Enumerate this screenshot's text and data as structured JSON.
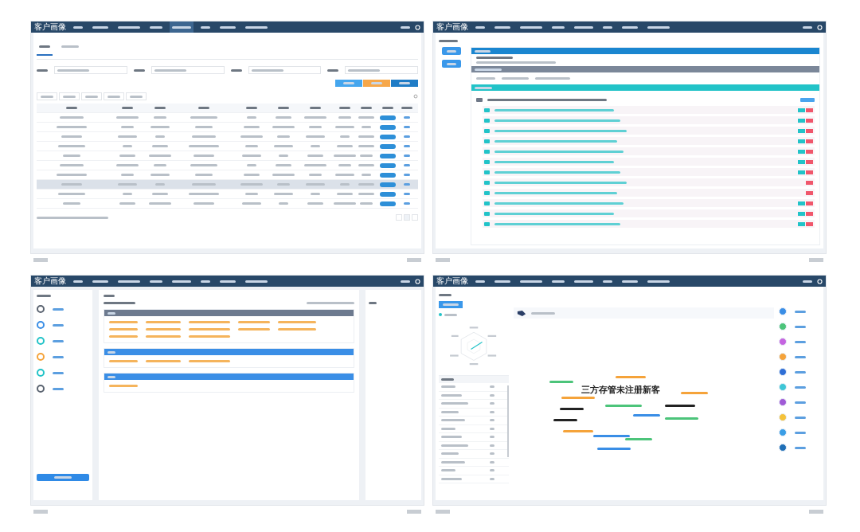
{
  "screens": [
    {
      "kind": "table",
      "brand": "客户画像",
      "nav": [
        {
          "selected": false
        },
        {
          "selected": false
        },
        {
          "selected": false
        },
        {
          "selected": false
        },
        {
          "selected": true
        },
        {
          "selected": false
        },
        {
          "selected": false
        },
        {
          "selected": false
        }
      ],
      "tabs": [
        {
          "selected": true
        },
        {
          "selected": false
        }
      ],
      "buttons": [
        {
          "color": "#45a6ee"
        },
        {
          "color": "#f6a74a"
        },
        {
          "color": "#1f7cc6"
        }
      ],
      "rows": [
        {
          "shaded": false
        },
        {
          "shaded": false
        },
        {
          "shaded": false
        },
        {
          "shaded": false
        },
        {
          "shaded": false
        },
        {
          "shaded": false
        },
        {
          "shaded": false
        },
        {
          "shaded": true
        },
        {
          "shaded": false
        },
        {
          "shaded": false
        }
      ]
    },
    {
      "kind": "timeline",
      "brand": "客户画像",
      "nav": [
        {
          "selected": false
        },
        {
          "selected": false
        },
        {
          "selected": false
        },
        {
          "selected": false
        },
        {
          "selected": false
        },
        {
          "selected": false
        },
        {
          "selected": false
        },
        {
          "selected": false
        }
      ],
      "sections": [
        {
          "color": "#1a86d0"
        },
        {
          "color": "#7b8799"
        },
        {
          "color": "#22c3c8"
        }
      ],
      "entries": [
        {
          "editable": true
        },
        {
          "editable": true
        },
        {
          "editable": true
        },
        {
          "editable": true
        },
        {
          "editable": true
        },
        {
          "editable": true
        },
        {
          "editable": true
        },
        {
          "editable": false
        },
        {
          "editable": false
        },
        {
          "editable": true
        },
        {
          "editable": true
        },
        {
          "editable": true
        }
      ]
    },
    {
      "kind": "tags",
      "brand": "客户画像",
      "nav": [
        {
          "selected": false
        },
        {
          "selected": false
        },
        {
          "selected": false
        },
        {
          "selected": false
        },
        {
          "selected": false
        },
        {
          "selected": false
        },
        {
          "selected": false
        },
        {
          "selected": false
        }
      ],
      "icons": [
        {
          "color": "#5a6370"
        },
        {
          "color": "#3a8ee6"
        },
        {
          "color": "#22c3c8"
        },
        {
          "color": "#f5a33a"
        },
        {
          "color": "#22c3c8"
        },
        {
          "color": "#5a6370"
        }
      ],
      "groups": [
        {
          "color": "#6d7a8f",
          "tags": [
            {
              "kind": "tag"
            },
            {
              "kind": "tag"
            },
            {
              "kind": "tag"
            },
            {
              "kind": "tag"
            },
            {
              "kind": "tag"
            },
            {
              "kind": "tag"
            },
            {
              "kind": "tag"
            },
            {
              "kind": "tag"
            },
            {
              "kind": "tag"
            },
            {
              "kind": "tag"
            },
            {
              "kind": "tag"
            },
            {
              "kind": "tag"
            },
            {
              "kind": "tag"
            }
          ]
        },
        {
          "color": "#3a8ee6",
          "tags": [
            {
              "kind": "tag"
            },
            {
              "kind": "tag"
            },
            {
              "kind": "tag"
            }
          ]
        },
        {
          "color": "#3a8ee6",
          "tags": [
            {
              "kind": "tag"
            }
          ]
        }
      ]
    },
    {
      "kind": "portrait",
      "brand": "客户画像",
      "nav": [
        {
          "selected": false
        },
        {
          "selected": false
        },
        {
          "selected": false
        },
        {
          "selected": false
        },
        {
          "selected": false
        },
        {
          "selected": false
        },
        {
          "selected": false
        },
        {
          "selected": false
        }
      ],
      "table_rows": [
        {
          "kind": "row"
        },
        {
          "kind": "row"
        },
        {
          "kind": "row"
        },
        {
          "kind": "row"
        },
        {
          "kind": "row"
        },
        {
          "kind": "row"
        },
        {
          "kind": "row"
        },
        {
          "kind": "row"
        },
        {
          "kind": "row"
        },
        {
          "kind": "row"
        },
        {
          "kind": "row"
        },
        {
          "kind": "row"
        }
      ],
      "words": [
        {
          "color": "#4cc47a"
        },
        {
          "color": "#f5a33a"
        },
        {
          "color": "#222222",
          "text": "三方存管未注册新客"
        },
        {
          "color": "#f5a33a"
        },
        {
          "color": "#f5a33a"
        },
        {
          "color": "#222222"
        },
        {
          "color": "#222222"
        },
        {
          "color": "#4cc47a"
        },
        {
          "color": "#3a8ee6"
        },
        {
          "color": "#4cc47a"
        },
        {
          "color": "#222222"
        },
        {
          "color": "#f5a33a"
        },
        {
          "color": "#3a8ee6"
        },
        {
          "color": "#4cc47a"
        },
        {
          "color": "#3a8ee6"
        }
      ],
      "icons": [
        {
          "color": "#3a8ee6"
        },
        {
          "color": "#4cc47a"
        },
        {
          "color": "#c564e0"
        },
        {
          "color": "#f5a33a"
        },
        {
          "color": "#2f6fd6"
        },
        {
          "color": "#3ec6d6"
        },
        {
          "color": "#a05ad6"
        },
        {
          "color": "#f5c23a"
        },
        {
          "color": "#3a9ee6"
        },
        {
          "color": "#1f6fb6"
        }
      ]
    }
  ]
}
